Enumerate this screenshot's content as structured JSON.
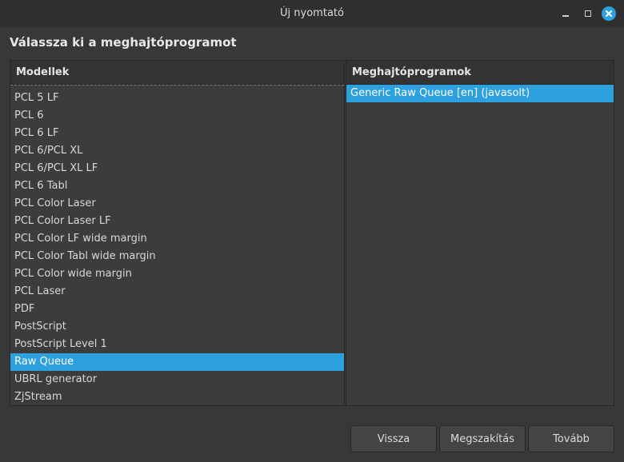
{
  "window": {
    "title": "Új nyomtató",
    "minimize_icon": "minimize-icon",
    "maximize_icon": "maximize-icon",
    "close_icon": "close-icon",
    "accent": "#2da0e0"
  },
  "heading": "Válassza ki a meghajtóprogramot",
  "models": {
    "header": "Modellek",
    "items": [
      "PCL 5 LF",
      "PCL 6",
      "PCL 6 LF",
      "PCL 6/PCL XL",
      "PCL 6/PCL XL LF",
      "PCL 6 Tabl",
      "PCL Color Laser",
      "PCL Color Laser LF",
      "PCL Color LF wide margin",
      "PCL Color Tabl wide margin",
      "PCL Color wide margin",
      "PCL Laser",
      "PDF",
      "PostScript",
      "PostScript Level 1",
      "Raw Queue",
      "UBRL generator",
      "ZjStream"
    ],
    "selected": "Raw Queue"
  },
  "drivers": {
    "header": "Meghajtóprogramok",
    "items": [
      "Generic Raw Queue [en] (javasolt)"
    ],
    "selected": "Generic Raw Queue [en] (javasolt)"
  },
  "buttons": {
    "back": "Vissza",
    "cancel": "Megszakítás",
    "next": "Tovább"
  }
}
